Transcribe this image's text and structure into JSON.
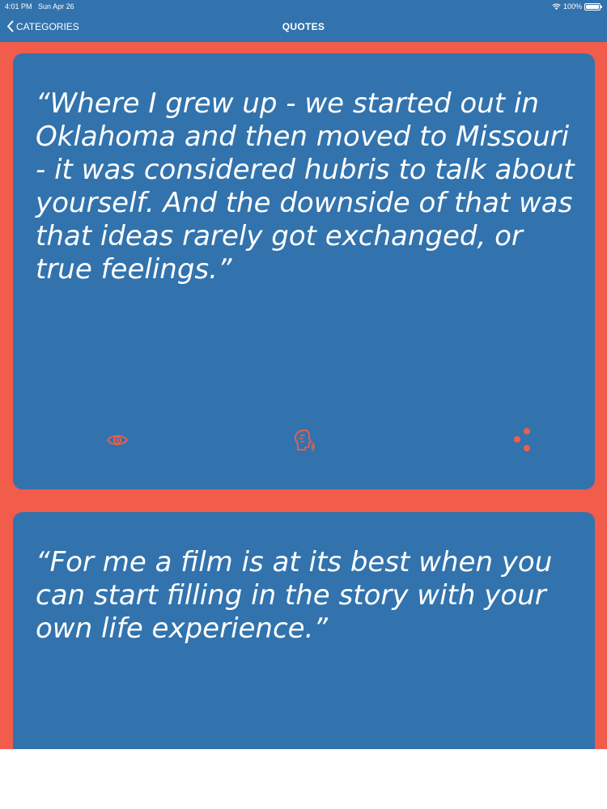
{
  "status_bar": {
    "time": "4:01 PM",
    "date": "Sun Apr 26",
    "battery_percent": "100%",
    "battery_level": 1.0
  },
  "nav": {
    "back_label": "CATEGORIES",
    "title": "QUOTES"
  },
  "quotes": [
    {
      "text": "“Where I grew up - we started out in Oklahoma and then moved to Missouri - it was considered hubris to talk about yourself. And the downside of that was that ideas rarely got exchanged, or true feelings.”",
      "actions": [
        "eye-icon",
        "author-head-icon",
        "share-icon"
      ]
    },
    {
      "text": "“For me a film is at its best when you can start filling in the story with your own life experience.”"
    }
  ],
  "colors": {
    "nav_background": "#3273ad",
    "card_background": "#3273ad",
    "page_background": "#f25c4a",
    "icon_color": "#f25c4a",
    "text_color": "#ffffff"
  }
}
